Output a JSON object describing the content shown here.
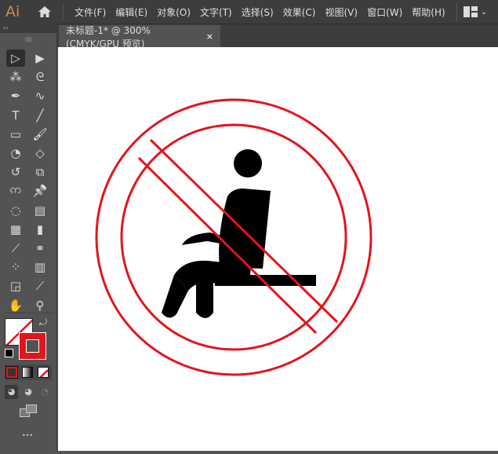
{
  "app": {
    "logo": "Ai",
    "home_icon": "home-icon",
    "layout_icon": "workspace-layout-icon"
  },
  "menu": [
    "文件(F)",
    "编辑(E)",
    "对象(O)",
    "文字(T)",
    "选择(S)",
    "效果(C)",
    "视图(V)",
    "窗口(W)",
    "帮助(H)"
  ],
  "document_tab": {
    "title": "未标题-1* @ 300% (CMYK/GPU 预览)",
    "close": "×"
  },
  "toolbar": {
    "collapse": "‹‹",
    "tools": [
      [
        "selection-tool",
        "▷"
      ],
      [
        "direct-selection-tool",
        "▶"
      ],
      [
        "magic-wand-tool",
        "⁂"
      ],
      [
        "lasso-tool",
        "ᘓ"
      ],
      [
        "pen-tool",
        "✒"
      ],
      [
        "curvature-tool",
        "∿"
      ],
      [
        "type-tool",
        "T"
      ],
      [
        "line-tool",
        "╱"
      ],
      [
        "rectangle-tool",
        "▭"
      ],
      [
        "paintbrush-tool",
        "🖌"
      ],
      [
        "shaper-tool",
        "◔"
      ],
      [
        "eraser-tool",
        "◇"
      ],
      [
        "rotate-tool",
        "↺"
      ],
      [
        "scale-tool",
        "⧉"
      ],
      [
        "warp-tool",
        "ဢ"
      ],
      [
        "puppet-warp-tool",
        "📌"
      ],
      [
        "shape-builder-tool",
        "◌"
      ],
      [
        "perspective-grid-tool",
        "▤"
      ],
      [
        "mesh-tool",
        "▦"
      ],
      [
        "gradient-tool",
        "▮"
      ],
      [
        "eyedropper-tool",
        "⟋"
      ],
      [
        "blend-tool",
        "⚭"
      ],
      [
        "symbol-sprayer-tool",
        "⁘"
      ],
      [
        "column-graph-tool",
        "▥"
      ],
      [
        "artboard-tool",
        "◲"
      ],
      [
        "slice-tool",
        "⟋"
      ],
      [
        "hand-tool",
        "✋"
      ],
      [
        "zoom-tool",
        "⚲"
      ]
    ],
    "more": "•••"
  },
  "colors": {
    "fill": "none",
    "stroke": "#e3151c",
    "sign_red": "#e3151c",
    "figure": "#000000"
  }
}
